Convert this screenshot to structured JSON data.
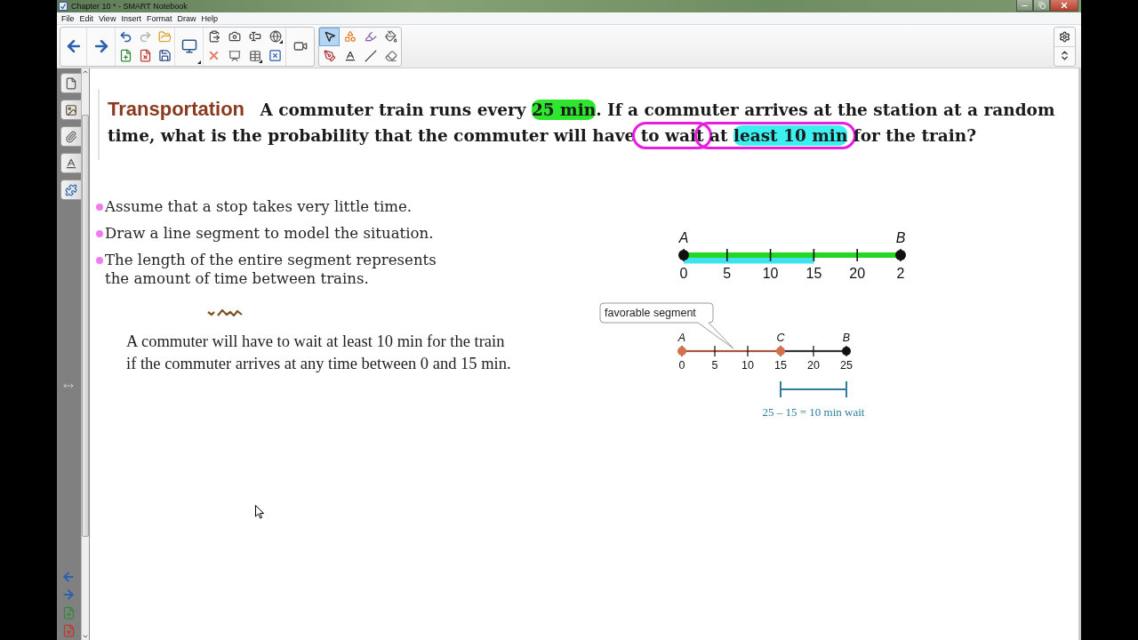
{
  "window": {
    "title": "Chapter 10 * - SMART Notebook"
  },
  "menu": [
    "File",
    "Edit",
    "View",
    "Insert",
    "Format",
    "Draw",
    "Help"
  ],
  "undo": {
    "disabled": false
  },
  "redo": {
    "disabled": true
  },
  "tools": [
    {
      "kind": "select",
      "selected": true
    },
    {
      "kind": "shapes",
      "selected": false
    },
    {
      "kind": "magic-pen",
      "selected": false
    },
    {
      "kind": "fill",
      "selected": false
    },
    {
      "kind": "pens",
      "selected": false
    },
    {
      "kind": "text",
      "selected": false
    },
    {
      "kind": "lines",
      "selected": false
    },
    {
      "kind": "eraser",
      "selected": false
    }
  ],
  "question": {
    "parts": [
      {
        "kind": "label",
        "text": "Transportation"
      },
      {
        "kind": "plain",
        "text": "A commuter train runs every "
      },
      {
        "kind": "highlight",
        "text": "25 min",
        "color": "#2ee62e"
      },
      {
        "kind": "plain",
        "text": ". If a commuter arrives at the station at a random time, what is the probability that the commuter will have "
      },
      {
        "kind": "circled",
        "parts": [
          {
            "kind": "plain",
            "text": "to wait"
          }
        ]
      },
      {
        "kind": "circled",
        "parts": [
          {
            "kind": "plain",
            "text": " at "
          },
          {
            "kind": "highlight",
            "text": "least 10 min",
            "color": "#3cf0f0"
          }
        ]
      },
      {
        "kind": "plain",
        "text": " for the train?"
      }
    ]
  },
  "bullets": [
    "Assume that a stop takes very little time.",
    "Draw a line segment to model the situation.",
    "The length of the entire segment represents the amount of time between trains."
  ],
  "explanation": "A commuter will have to wait at least 10 min for the train if the commuter arrives at any time between 0 and 15 min.",
  "number_lines": [
    {
      "ticks": [
        {
          "label": "0",
          "point": {
            "label": "A",
            "color": "#111111"
          }
        },
        {
          "label": "5"
        },
        {
          "label": "10"
        },
        {
          "label": "15"
        },
        {
          "label": "20"
        },
        {
          "label": "2",
          "point": {
            "label": "B",
            "color": "#111111"
          }
        }
      ],
      "segments": [
        {
          "color": "#22d822",
          "highlighted": true
        },
        {
          "color": "#22d822",
          "highlighted": true
        },
        {
          "color": "#22d822",
          "highlighted": true
        },
        {
          "color": "#22d822",
          "highlighted": false
        },
        {
          "color": "#22d822",
          "highlighted": false
        }
      ]
    },
    {
      "callout": "favorable segment",
      "ticks": [
        {
          "label": "0",
          "point": {
            "label": "A",
            "color": "#d4714c"
          }
        },
        {
          "label": "5"
        },
        {
          "label": "10"
        },
        {
          "label": "15",
          "point": {
            "label": "C",
            "color": "#d4714c"
          }
        },
        {
          "label": "20"
        },
        {
          "label": "25",
          "point": {
            "label": "B",
            "color": "#111111"
          }
        }
      ],
      "segments": [
        {
          "color": "#a9553a",
          "bracketed": false
        },
        {
          "color": "#a9553a",
          "bracketed": false
        },
        {
          "color": "#a9553a",
          "bracketed": false
        },
        {
          "color": "#333333",
          "bracketed": true
        },
        {
          "color": "#333333",
          "bracketed": true
        }
      ],
      "bracket_label": "25 – 15 = 10 min wait"
    }
  ]
}
